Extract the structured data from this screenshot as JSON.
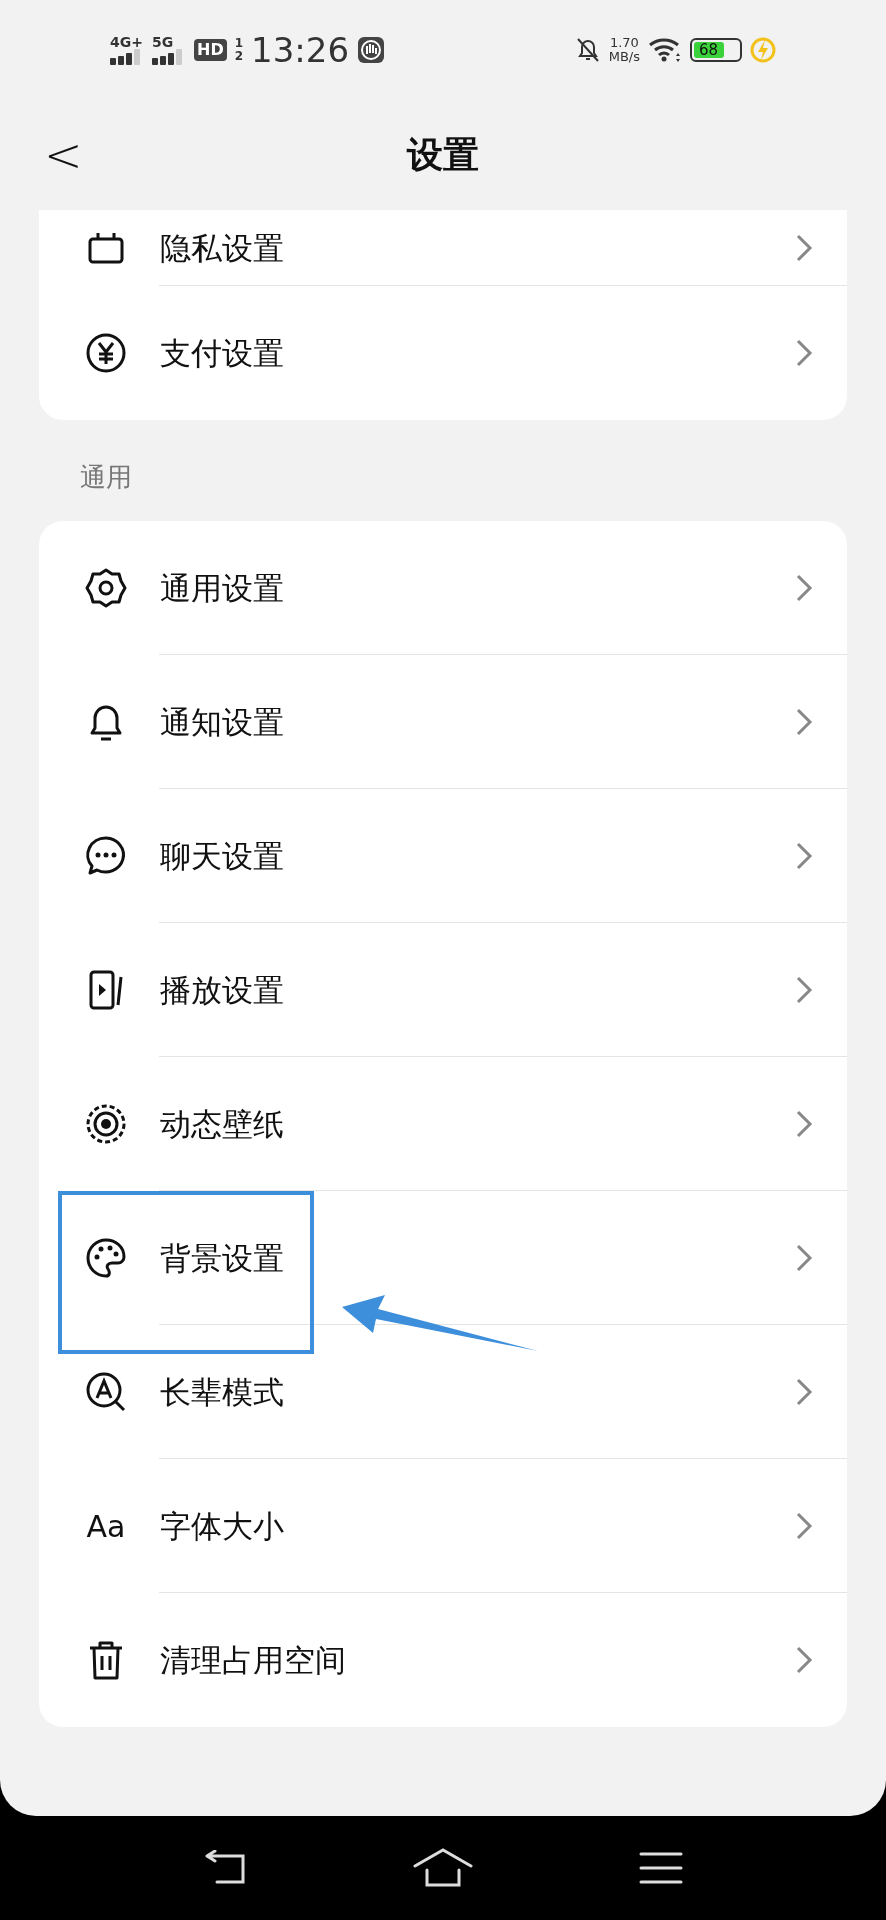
{
  "status_bar": {
    "network_1": "4G+",
    "network_2": "5G",
    "hd_badge": "HD",
    "hd_sup": "1",
    "hd_sub": "2",
    "time": "13:26",
    "speed_value": "1.70",
    "speed_unit": "MB/s",
    "battery": {
      "text": "68",
      "level": 0.68
    }
  },
  "header": {
    "back": "<",
    "title": "设置"
  },
  "sections": [
    {
      "items": [
        {
          "label": "隐私设置",
          "highlighted": false
        },
        {
          "label": "支付设置",
          "highlighted": false
        }
      ]
    },
    {
      "title": "通用",
      "items": [
        {
          "label": "通用设置",
          "highlighted": false
        },
        {
          "label": "通知设置",
          "highlighted": false
        },
        {
          "label": "聊天设置",
          "highlighted": false
        },
        {
          "label": "播放设置",
          "highlighted": false
        },
        {
          "label": "动态壁纸",
          "highlighted": false
        },
        {
          "label": "背景设置",
          "highlighted": true
        },
        {
          "label": "长辈模式",
          "highlighted": false
        },
        {
          "label": "字体大小",
          "icon_text": "Aa",
          "highlighted": false
        },
        {
          "label": "清理占用空间",
          "highlighted": false
        }
      ]
    }
  ]
}
